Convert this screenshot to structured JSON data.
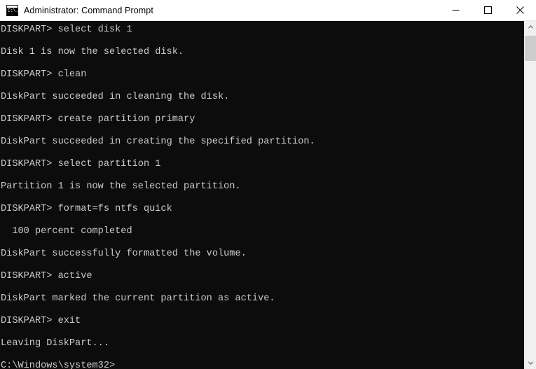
{
  "window": {
    "title": "Administrator: Command Prompt",
    "icon": "command-prompt-icon",
    "icon_glyph": "C:\\.",
    "background_color": "#0c0c0c",
    "text_color": "#cccccc",
    "titlebar_color": "#ffffff"
  },
  "caption_buttons": [
    {
      "name": "minimize-button",
      "label": "Minimize",
      "icon": "minimize-icon"
    },
    {
      "name": "maximize-button",
      "label": "Maximize",
      "icon": "maximize-icon"
    },
    {
      "name": "close-button",
      "label": "Close",
      "icon": "close-icon"
    }
  ],
  "console": {
    "lines": [
      "DISKPART> select disk 1",
      "",
      "Disk 1 is now the selected disk.",
      "",
      "DISKPART> clean",
      "",
      "DiskPart succeeded in cleaning the disk.",
      "",
      "DISKPART> create partition primary",
      "",
      "DiskPart succeeded in creating the specified partition.",
      "",
      "DISKPART> select partition 1",
      "",
      "Partition 1 is now the selected partition.",
      "",
      "DISKPART> format=fs ntfs quick",
      "",
      "  100 percent completed",
      "",
      "DiskPart successfully formatted the volume.",
      "",
      "DISKPART> active",
      "",
      "DiskPart marked the current partition as active.",
      "",
      "DISKPART> exit",
      "",
      "Leaving DiskPart...",
      "",
      "C:\\Windows\\system32>"
    ]
  },
  "scrollbar": {
    "up_arrow": "chevron-up-icon",
    "down_arrow": "chevron-down-icon",
    "thumb_color": "#cdcdcd",
    "track_color": "#f0f0f0"
  }
}
